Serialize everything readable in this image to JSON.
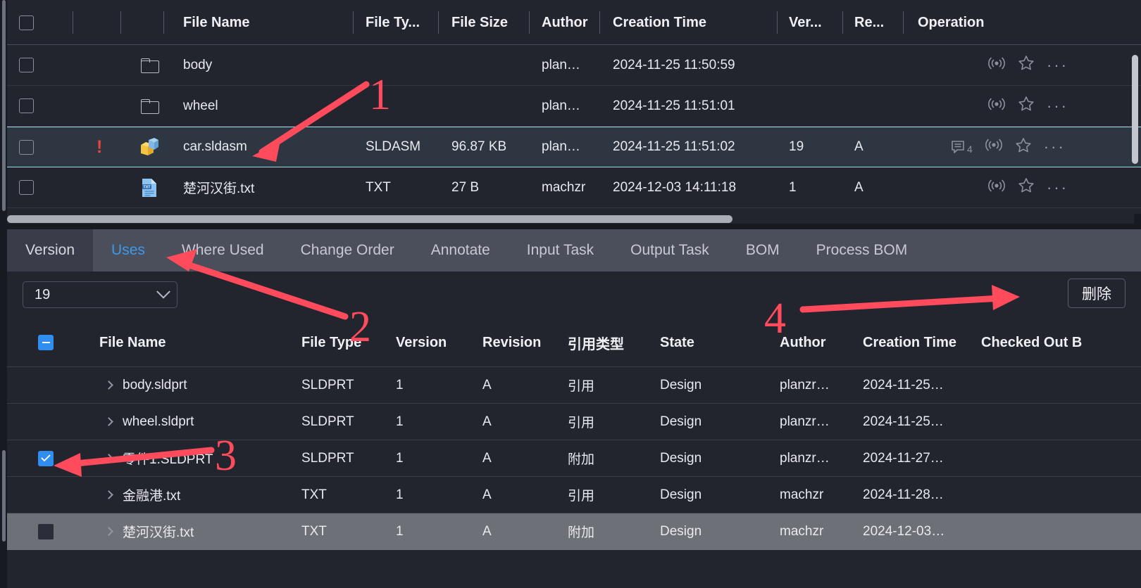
{
  "top_table": {
    "columns": [
      "File Name",
      "File Ty...",
      "File Size",
      "Author",
      "Creation Time",
      "Ver...",
      "Re...",
      "Operation"
    ],
    "rows": [
      {
        "icon": "folder-icon",
        "flag": "",
        "name": "body",
        "type": "",
        "size": "",
        "author": "plan…",
        "created": "2024-11-25 11:50:59",
        "version": "",
        "revision": "",
        "comment_count": "",
        "selected": false
      },
      {
        "icon": "folder-icon",
        "flag": "",
        "name": "wheel",
        "type": "",
        "size": "",
        "author": "plan…",
        "created": "2024-11-25 11:51:01",
        "version": "",
        "revision": "",
        "comment_count": "",
        "selected": false
      },
      {
        "icon": "assembly-icon",
        "flag": "!",
        "name": "car.sldasm",
        "type": "SLDASM",
        "size": "96.87 KB",
        "author": "plan…",
        "created": "2024-11-25 11:51:02",
        "version": "19",
        "revision": "A",
        "comment_count": "4",
        "selected": true
      },
      {
        "icon": "txt-file-icon",
        "flag": "",
        "name": "楚河汉街.txt",
        "type": "TXT",
        "size": "27 B",
        "author": "machzr",
        "created": "2024-12-03 14:11:18",
        "version": "1",
        "revision": "A",
        "comment_count": "",
        "selected": false
      }
    ]
  },
  "tabs": [
    {
      "label": "Version",
      "state": "pane"
    },
    {
      "label": "Uses",
      "state": "active"
    },
    {
      "label": "Where Used",
      "state": "normal"
    },
    {
      "label": "Change Order",
      "state": "normal"
    },
    {
      "label": "Annotate",
      "state": "normal"
    },
    {
      "label": "Input Task",
      "state": "normal"
    },
    {
      "label": "Output Task",
      "state": "normal"
    },
    {
      "label": "BOM",
      "state": "normal"
    },
    {
      "label": "Process BOM",
      "state": "normal"
    }
  ],
  "toolbar": {
    "version_value": "19",
    "delete_label": "删除"
  },
  "bottom_table": {
    "columns": [
      "File Name",
      "File Type",
      "Version",
      "Revision",
      "引用类型",
      "State",
      "Author",
      "Creation Time",
      "Checked Out B"
    ],
    "rows": [
      {
        "checkbox": "unchecked",
        "name": "body.sldprt",
        "type": "SLDPRT",
        "version": "1",
        "revision": "A",
        "ref_type": "引用",
        "state": "Design",
        "author": "planzr…",
        "created": "2024-11-25…",
        "highlight": false
      },
      {
        "checkbox": "unchecked",
        "name": "wheel.sldprt",
        "type": "SLDPRT",
        "version": "1",
        "revision": "A",
        "ref_type": "引用",
        "state": "Design",
        "author": "planzr…",
        "created": "2024-11-25…",
        "highlight": false
      },
      {
        "checkbox": "checked",
        "name": "零件1.SLDPRT",
        "type": "SLDPRT",
        "version": "1",
        "revision": "A",
        "ref_type": "附加",
        "state": "Design",
        "author": "planzr…",
        "created": "2024-11-27…",
        "highlight": false
      },
      {
        "checkbox": "unchecked",
        "name": "金融港.txt",
        "type": "TXT",
        "version": "1",
        "revision": "A",
        "ref_type": "引用",
        "state": "Design",
        "author": "machzr",
        "created": "2024-11-28…",
        "highlight": false
      },
      {
        "checkbox": "dark",
        "name": "楚河汉街.txt",
        "type": "TXT",
        "version": "1",
        "revision": "A",
        "ref_type": "附加",
        "state": "Design",
        "author": "machzr",
        "created": "2024-12-03…",
        "highlight": true
      }
    ]
  },
  "annotations": {
    "color": "#ff4b5c",
    "markers": [
      {
        "label": "1"
      },
      {
        "label": "2"
      },
      {
        "label": "3"
      },
      {
        "label": "4"
      }
    ]
  }
}
